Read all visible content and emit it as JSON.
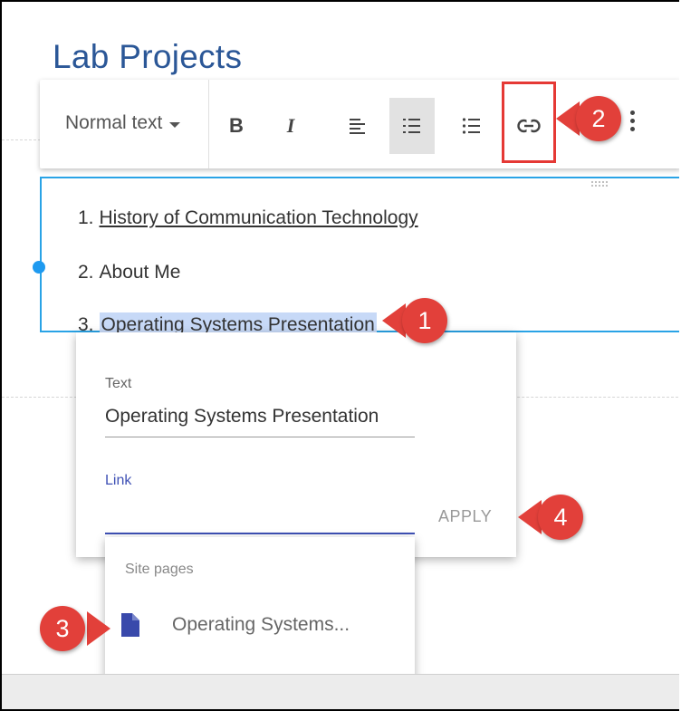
{
  "page": {
    "title": "Lab Projects"
  },
  "toolbar": {
    "style_label": "Normal text",
    "bold_label": "B",
    "italic_label": "I"
  },
  "list": {
    "items": [
      {
        "number": "1.",
        "text": "History of Communication Technology"
      },
      {
        "number": "2.",
        "text": "About Me"
      },
      {
        "number": "3.",
        "text": "Operating Systems Presentation"
      }
    ]
  },
  "link_dialog": {
    "text_label": "Text",
    "text_value": "Operating Systems Presentation",
    "link_label": "Link",
    "link_value": "",
    "apply_label": "APPLY"
  },
  "suggestions": {
    "header": "Site pages",
    "items": [
      {
        "label": "Operating Systems..."
      }
    ]
  },
  "callouts": [
    "1",
    "2",
    "3",
    "4"
  ],
  "colors": {
    "title": "#2b5797",
    "accent_blue": "#29a3e6",
    "selection": "#c7d9f7",
    "callout_red": "#e2403a",
    "highlight_box": "#e53935",
    "input_active": "#3f51b5",
    "doc_icon": "#3949ab"
  }
}
